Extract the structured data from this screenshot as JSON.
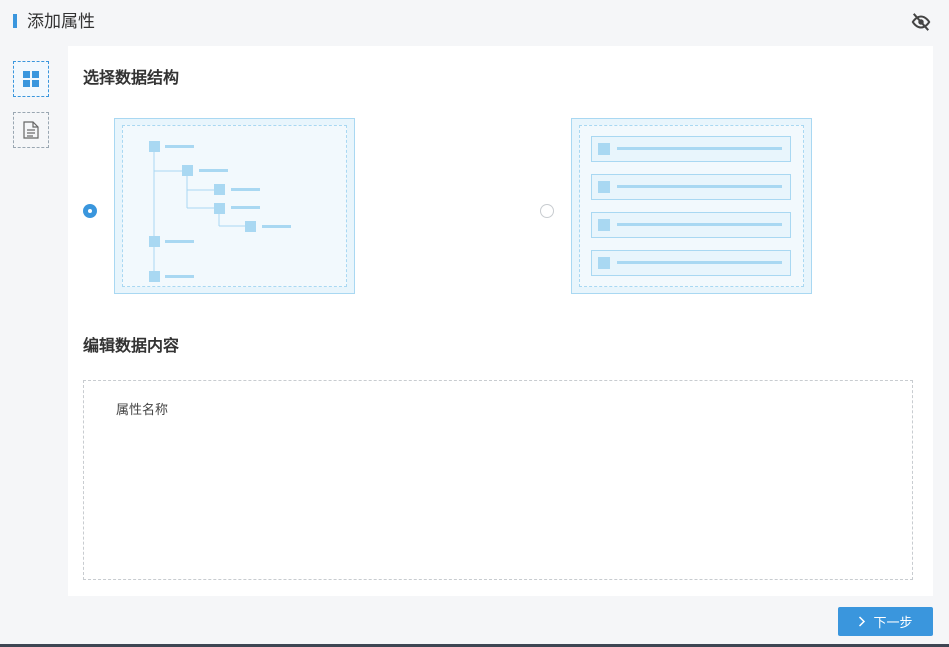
{
  "header": {
    "title": "添加属性",
    "icon": "eye-slash-icon"
  },
  "toolbar": {
    "items": [
      {
        "icon": "grid-icon",
        "active": true
      },
      {
        "icon": "document-icon",
        "active": false
      }
    ]
  },
  "structure": {
    "title": "选择数据结构",
    "options": [
      {
        "type": "tree",
        "selected": true
      },
      {
        "type": "list",
        "selected": false
      }
    ]
  },
  "content": {
    "title": "编辑数据内容",
    "field_label": "属性名称"
  },
  "footer": {
    "next_label": "下一步"
  },
  "colors": {
    "accent": "#3a96dd",
    "card_border": "#a9d8f2",
    "card_fill": "#e8f5fc"
  }
}
